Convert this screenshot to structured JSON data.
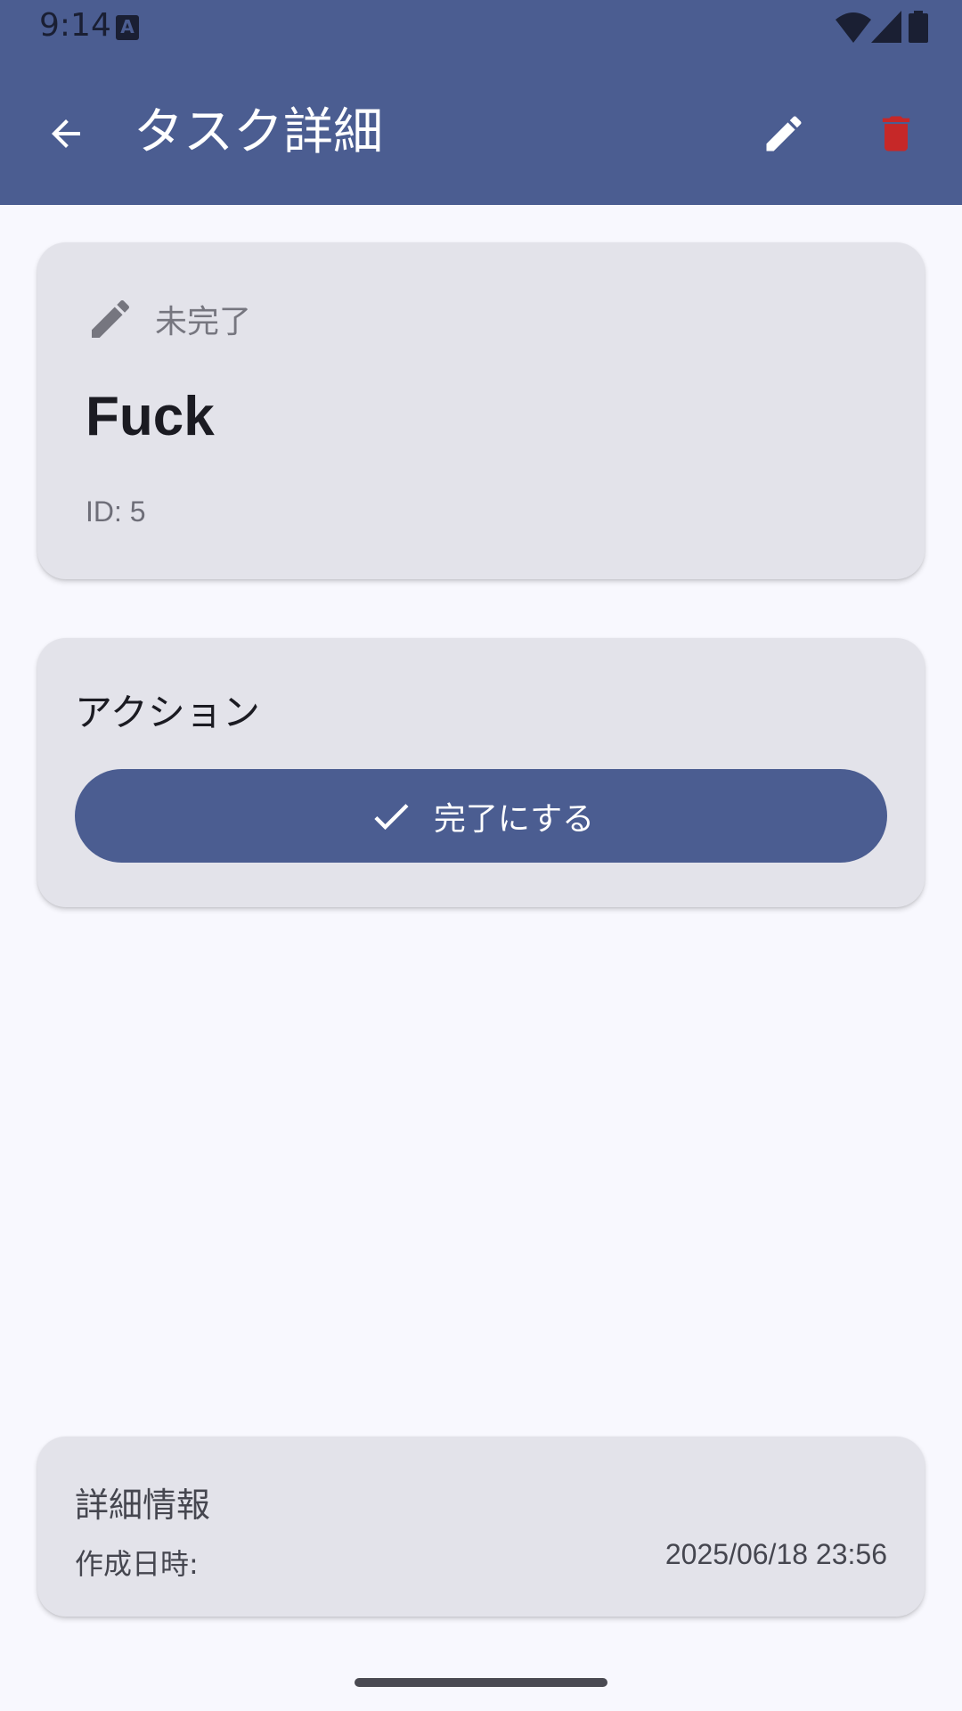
{
  "status_bar": {
    "time": "9:14",
    "notification_icon_letter": "A"
  },
  "app_bar": {
    "title": "タスク詳細",
    "icons": {
      "back": "arrow-back-icon",
      "edit": "edit-icon",
      "delete": "delete-icon"
    },
    "colors": {
      "background": "#4b5d91",
      "delete_icon": "#c62828"
    }
  },
  "task_card": {
    "status_icon": "pencil-icon",
    "status": "未完了",
    "title": "Fuck",
    "id_text": "ID: 5"
  },
  "actions_card": {
    "title": "アクション",
    "complete_button": {
      "icon": "check-icon",
      "label": "完了にする"
    }
  },
  "info_card": {
    "title": "詳細情報",
    "created_label": "作成日時:",
    "created_value": "2025/06/18 23:56"
  }
}
